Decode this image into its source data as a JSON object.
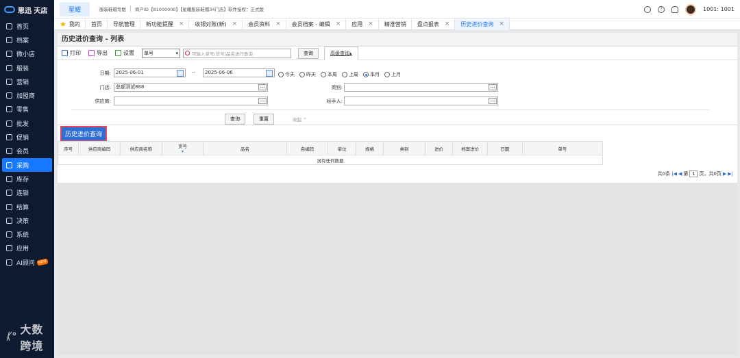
{
  "sidebar": {
    "logo": "思迅 天店",
    "items": [
      {
        "label": "首页",
        "icon": "home-icon"
      },
      {
        "label": "档案",
        "icon": "folder-icon"
      },
      {
        "label": "微小店",
        "icon": "shop-icon"
      },
      {
        "label": "服装",
        "icon": "shirt-icon"
      },
      {
        "label": "营销",
        "icon": "marketing-icon"
      },
      {
        "label": "加盟商",
        "icon": "franchise-icon"
      },
      {
        "label": "零售",
        "icon": "retail-icon"
      },
      {
        "label": "批发",
        "icon": "wholesale-icon"
      },
      {
        "label": "促销",
        "icon": "promotion-icon"
      },
      {
        "label": "会员",
        "icon": "member-icon"
      },
      {
        "label": "采购",
        "icon": "cart-icon"
      },
      {
        "label": "库存",
        "icon": "stock-icon"
      },
      {
        "label": "连锁",
        "icon": "chain-icon"
      },
      {
        "label": "结算",
        "icon": "settle-icon"
      },
      {
        "label": "决策",
        "icon": "decision-icon"
      },
      {
        "label": "系统",
        "icon": "system-icon"
      },
      {
        "label": "应用",
        "icon": "app-icon"
      },
      {
        "label": "AI顾问",
        "icon": "ai-icon",
        "badge": "NEW"
      }
    ],
    "active_index": 10,
    "watermark": "大数跨境"
  },
  "topbar": {
    "brand": "星耀",
    "edition": "服装鞋帽专版",
    "merchant": "商户ID【81000000】【星耀服装鞋帽34门店】软件授权：正式版",
    "user": "1001: 1001"
  },
  "tabs": [
    {
      "label": "我的",
      "closable": false,
      "star": true
    },
    {
      "label": "首页",
      "closable": false
    },
    {
      "label": "导航管理",
      "closable": false
    },
    {
      "label": "新功能提醒",
      "closable": true
    },
    {
      "label": "收银对账(新)",
      "closable": true
    },
    {
      "label": "会员资料",
      "closable": true
    },
    {
      "label": "会员档案 - 编辑",
      "closable": true
    },
    {
      "label": "应用",
      "closable": true
    },
    {
      "label": "精准营销",
      "closable": false
    },
    {
      "label": "盘点报表",
      "closable": true
    },
    {
      "label": "历史进价查询",
      "closable": true,
      "active": true
    }
  ],
  "page": {
    "title": "历史进价查询 - 列表",
    "toolbar": {
      "print": "打印",
      "export": "导出",
      "settings": "设置",
      "select_value": "单号",
      "search_placeholder": "可输入单号/货号/品名进行查询",
      "query": "查询",
      "advanced": "高级查询"
    },
    "filters": {
      "date_label": "日期:",
      "date_from": "2025-06-01",
      "date_sep": "--",
      "date_to": "2025-06-06",
      "radios": [
        "今天",
        "昨天",
        "本周",
        "上周",
        "本月",
        "上月"
      ],
      "radio_selected": "本月",
      "store_label": "门店:",
      "store_value": "总部测试888",
      "category_label": "类别:",
      "category_value": "",
      "supplier_label": "供应商:",
      "supplier_value": "",
      "handler_label": "经手人:",
      "handler_value": "",
      "query_btn": "查询",
      "reset_btn": "重置",
      "collapse": "收起 ^"
    },
    "section_title": "历史进价查询",
    "table": {
      "columns": [
        "序号",
        "供应商编码",
        "供应商名称",
        "货号",
        "品名",
        "自编码",
        "单位",
        "规格",
        "类别",
        "进价",
        "档案进价",
        "日期",
        "单号"
      ],
      "empty_text": "没有任何数据"
    },
    "pager": {
      "total": "共0条",
      "page_prefix": "第",
      "page_value": "1",
      "page_suffix": "页，共0页"
    }
  }
}
